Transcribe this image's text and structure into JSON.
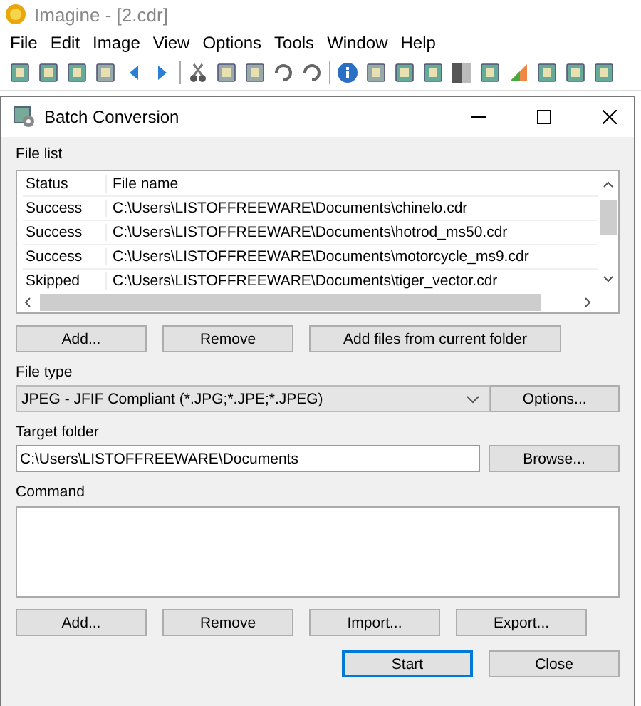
{
  "app": {
    "title": "Imagine - [2.cdr]",
    "menu": [
      "File",
      "Edit",
      "Image",
      "View",
      "Options",
      "Tools",
      "Window",
      "Help"
    ]
  },
  "dialog": {
    "title": "Batch Conversion",
    "file_list": {
      "label": "File list",
      "columns": [
        "Status",
        "File name"
      ],
      "rows": [
        {
          "status": "Success",
          "file": "C:\\Users\\LISTOFFREEWARE\\Documents\\chinelo.cdr"
        },
        {
          "status": "Success",
          "file": "C:\\Users\\LISTOFFREEWARE\\Documents\\hotrod_ms50.cdr"
        },
        {
          "status": "Success",
          "file": "C:\\Users\\LISTOFFREEWARE\\Documents\\motorcycle_ms9.cdr"
        },
        {
          "status": "Skipped",
          "file": "C:\\Users\\LISTOFFREEWARE\\Documents\\tiger_vector.cdr"
        }
      ],
      "buttons": [
        "Add...",
        "Remove",
        "Add files from current folder"
      ]
    },
    "file_type": {
      "label": "File type",
      "value": "JPEG - JFIF Compliant (*.JPG;*.JPE;*.JPEG)",
      "button": "Options..."
    },
    "target_folder": {
      "label": "Target folder",
      "value": "C:\\Users\\LISTOFFREEWARE\\Documents",
      "button": "Browse..."
    },
    "command": {
      "label": "Command",
      "buttons": [
        "Add...",
        "Remove",
        "Import...",
        "Export..."
      ]
    },
    "footer_buttons": [
      {
        "label": "Start",
        "default": true
      },
      {
        "label": "Close",
        "default": false
      }
    ]
  }
}
